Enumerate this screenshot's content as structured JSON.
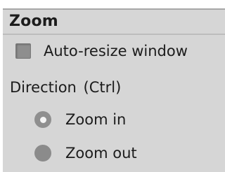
{
  "section": {
    "title": "Zoom"
  },
  "auto_resize": {
    "label": "Auto-resize window",
    "checked": false
  },
  "direction": {
    "label": "Direction  (Ctrl)",
    "options": [
      {
        "label": "Zoom in",
        "selected": true
      },
      {
        "label": "Zoom out",
        "selected": false
      }
    ]
  }
}
